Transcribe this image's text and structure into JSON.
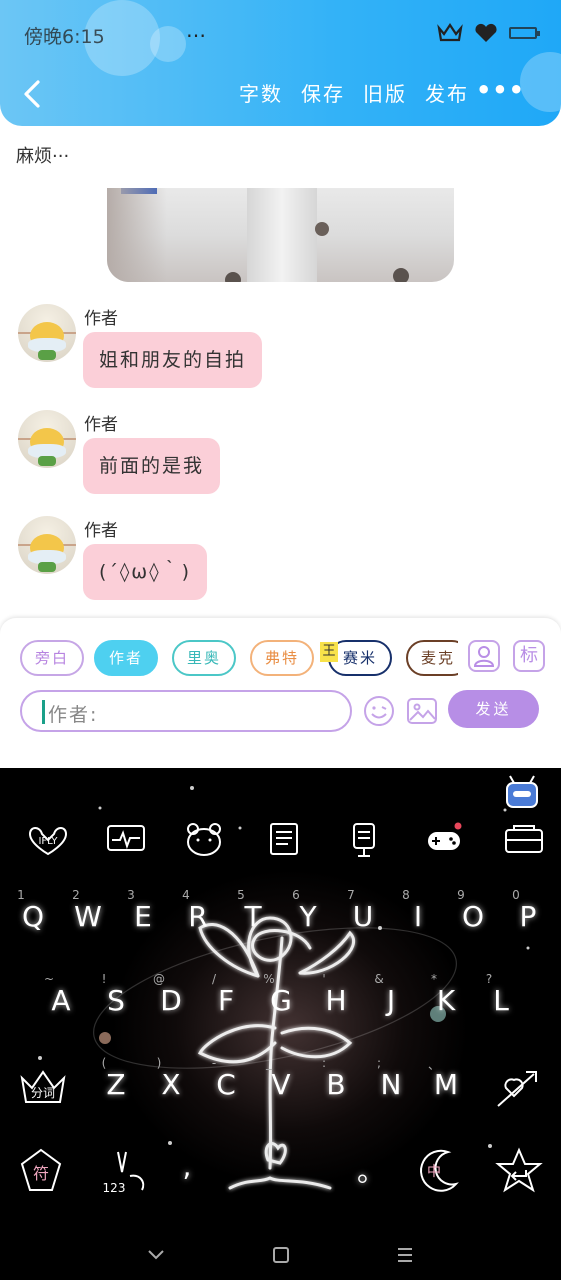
{
  "status": {
    "time": "傍晚6:15",
    "extra": "…"
  },
  "header": {
    "actions": [
      "字数",
      "保存",
      "旧版",
      "发布"
    ],
    "more": "•••"
  },
  "chat": {
    "narration": "麻烦···",
    "messages": [
      {
        "author": "作者",
        "text": "姐和朋友的自拍"
      },
      {
        "author": "作者",
        "text": "前面的是我"
      },
      {
        "author": "作者",
        "text": "(´◊ω◊｀)"
      }
    ]
  },
  "composer": {
    "characters": [
      "旁白",
      "作者",
      "里奥",
      "弗特",
      "赛米",
      "麦克"
    ],
    "crown_tag": "王",
    "role_icon_label": "标",
    "input_value": "作者:",
    "send_label": "发送"
  },
  "keyboard": {
    "row1": [
      {
        "k": "Q",
        "s": "1"
      },
      {
        "k": "W",
        "s": "2"
      },
      {
        "k": "E",
        "s": "3"
      },
      {
        "k": "R",
        "s": "4"
      },
      {
        "k": "T",
        "s": "5"
      },
      {
        "k": "Y",
        "s": "6"
      },
      {
        "k": "U",
        "s": "7"
      },
      {
        "k": "I",
        "s": "8"
      },
      {
        "k": "O",
        "s": "9"
      },
      {
        "k": "P",
        "s": "0"
      }
    ],
    "row2": [
      {
        "k": "A",
        "s": "~"
      },
      {
        "k": "S",
        "s": "!"
      },
      {
        "k": "D",
        "s": "@"
      },
      {
        "k": "F",
        "s": "/"
      },
      {
        "k": "G",
        "s": "%"
      },
      {
        "k": "H",
        "s": "'"
      },
      {
        "k": "J",
        "s": "&"
      },
      {
        "k": "K",
        "s": "*"
      },
      {
        "k": "L",
        "s": "?"
      }
    ],
    "row3": [
      {
        "k": "Z",
        "s": "("
      },
      {
        "k": "X",
        "s": ")"
      },
      {
        "k": "C",
        "s": "-"
      },
      {
        "k": "V",
        "s": "_"
      },
      {
        "k": "B",
        "s": ":"
      },
      {
        "k": "N",
        "s": ";"
      },
      {
        "k": "M",
        "s": "、"
      }
    ],
    "fenci": "分词",
    "symbols": "符",
    "num": "123",
    "comma": ",",
    "period": "。",
    "lang": "中",
    "top_key": "IFLY"
  }
}
